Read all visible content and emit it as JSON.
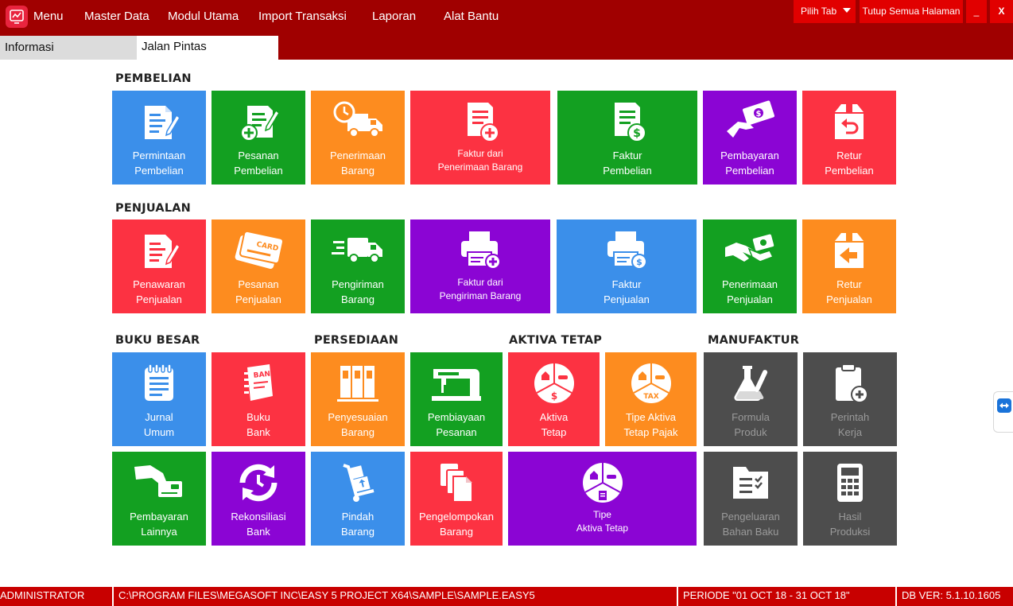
{
  "menu": {
    "menu_label": "Menu",
    "items": [
      "Master Data",
      "Modul Utama",
      "Import Transaksi",
      "Laporan",
      "Alat Bantu"
    ]
  },
  "window_controls": {
    "pick_tab": "Pilih Tab",
    "close_all": "Tutup Semua Halaman",
    "minimize": "_",
    "close": "X"
  },
  "tabs": [
    "Informasi",
    "Jalan Pintas"
  ],
  "active_tab": "Jalan Pintas",
  "sections": {
    "pembelian": "PEMBELIAN",
    "penjualan": "PENJUALAN",
    "buku_besar": "BUKU BESAR",
    "persediaan": "PERSEDIAAN",
    "aktiva_tetap": "AKTIVA TETAP",
    "manufaktur": "MANUFAKTUR"
  },
  "tiles": {
    "permintaan_pembelian": [
      "Permintaan",
      "Pembelian"
    ],
    "pesanan_pembelian": [
      "Pesanan",
      "Pembelian"
    ],
    "penerimaan_barang": [
      "Penerimaan",
      "Barang"
    ],
    "faktur_penerimaan": [
      "Faktur dari",
      "Penerimaan Barang"
    ],
    "faktur_pembelian": [
      "Faktur",
      "Pembelian"
    ],
    "pembayaran_pembelian": [
      "Pembayaran",
      "Pembelian"
    ],
    "retur_pembelian": [
      "Retur",
      "Pembelian"
    ],
    "penawaran_penjualan": [
      "Penawaran",
      "Penjualan"
    ],
    "pesanan_penjualan": [
      "Pesanan",
      "Penjualan"
    ],
    "pengiriman_barang": [
      "Pengiriman",
      "Barang"
    ],
    "faktur_pengiriman": [
      "Faktur dari",
      "Pengiriman Barang"
    ],
    "faktur_penjualan": [
      "Faktur",
      "Penjualan"
    ],
    "penerimaan_penjualan": [
      "Penerimaan",
      "Penjualan"
    ],
    "retur_penjualan": [
      "Retur",
      "Penjualan"
    ],
    "jurnal_umum": [
      "Jurnal",
      "Umum"
    ],
    "buku_bank": [
      "Buku",
      "Bank"
    ],
    "penyesuaian_barang": [
      "Penyesuaian",
      "Barang"
    ],
    "pembiayaan_pesanan": [
      "Pembiayaan",
      "Pesanan"
    ],
    "aktiva_tetap": [
      "Aktiva",
      "Tetap"
    ],
    "tipe_aktiva_pajak": [
      "Tipe Aktiva",
      "Tetap Pajak"
    ],
    "formula_produk": [
      "Formula",
      "Produk"
    ],
    "perintah_kerja": [
      "Perintah",
      "Kerja"
    ],
    "pembayaran_lainnya": [
      "Pembayaran",
      "Lainnya"
    ],
    "rekonsiliasi_bank": [
      "Rekonsiliasi",
      "Bank"
    ],
    "pindah_barang": [
      "Pindah",
      "Barang"
    ],
    "pengelompokan_barang": [
      "Pengelompokan",
      "Barang"
    ],
    "tipe_aktiva_tetap": [
      "Tipe",
      "Aktiva Tetap"
    ],
    "pengeluaran_bahan_baku": [
      "Pengeluaran",
      "Bahan Baku"
    ],
    "hasil_produksi": [
      "Hasil",
      "Produksi"
    ]
  },
  "icon_text": {
    "card": "CARD",
    "bank": "BANK",
    "tax": "TAX"
  },
  "status": {
    "user": "ADMINISTRATOR",
    "path": "C:\\PROGRAM FILES\\MEGASOFT INC\\EASY 5 PROJECT X64\\SAMPLE\\SAMPLE.EASY5",
    "period": "PERIODE \"01 OCT 18 - 31 OCT 18\"",
    "db_version": "DB VER: 5.1.10.1605"
  },
  "colors": {
    "topbar": "#a00000",
    "statusbar": "#c80000",
    "blue": "#3b8fea",
    "green": "#13a021",
    "orange": "#fd8c1f",
    "red": "#fc3242",
    "purple": "#8b05d4",
    "gray": "#4d4d4d"
  }
}
